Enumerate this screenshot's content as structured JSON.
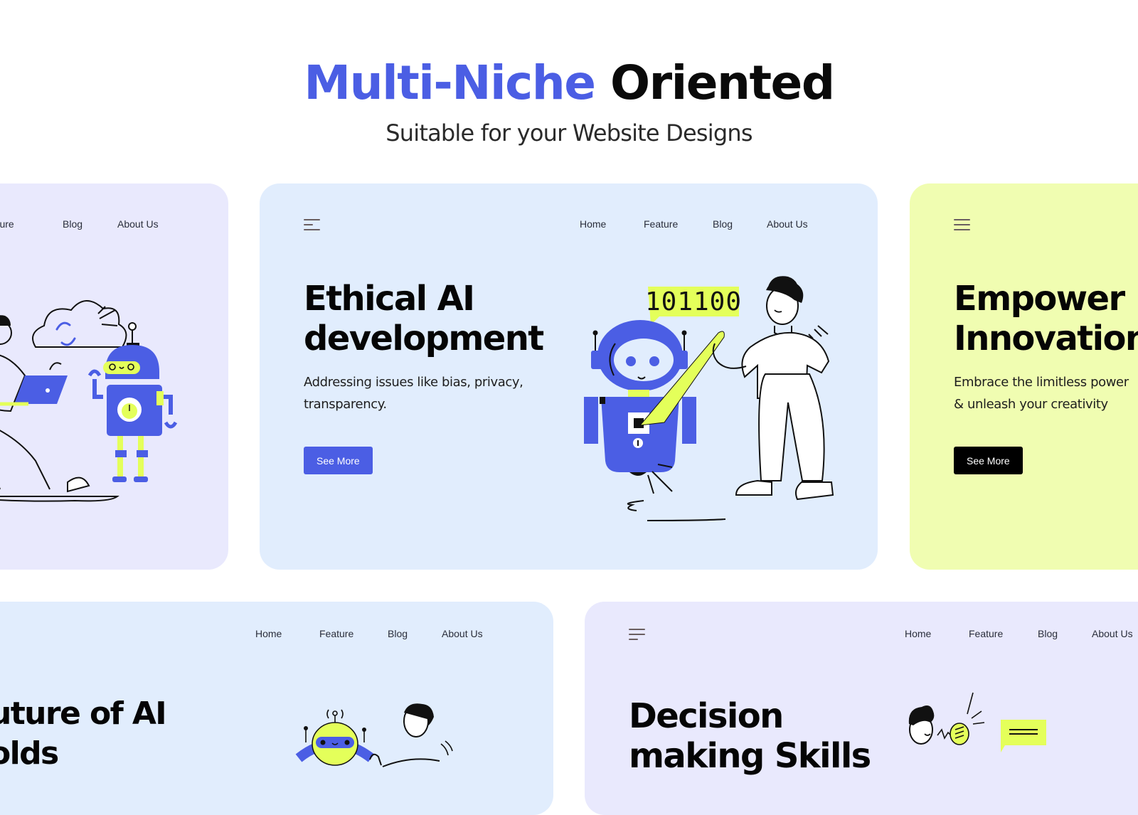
{
  "header": {
    "title_accent": "Multi-Niche",
    "title_rest": "Oriented",
    "subtitle": "Suitable for your Website Designs"
  },
  "colors": {
    "accent_blue": "#4b5ee4",
    "lime": "#e4ff5a",
    "card_lavender": "#e9e9fd",
    "card_blue": "#e1edfd",
    "card_lime": "#f0fdb1"
  },
  "nav_items": [
    "Home",
    "Feature",
    "Blog",
    "About Us"
  ],
  "cards": [
    {
      "nav_visible": [
        "eature",
        "Blog",
        "About Us"
      ],
      "illustration": "person-with-laptop-and-robot-with-cloud-sync"
    },
    {
      "headline_line1": "Ethical AI",
      "headline_line2": "development",
      "description_line1": "Addressing issues like bias, privacy,",
      "description_line2": "transparency.",
      "button_label": "See More",
      "speech_bubble_text": "101100",
      "illustration": "robot-and-person-high-five"
    },
    {
      "headline_line1": "Empower",
      "headline_line2": "Innovation",
      "description_line1": "Embrace the limitless power",
      "description_line2": "& unleash your creativity",
      "button_label": "See More"
    },
    {
      "headline_line1": "uture of AI",
      "headline_line2": "olds",
      "illustration": "robot-waving-and-person"
    },
    {
      "headline_line1": "Decision",
      "headline_line2": "making Skills",
      "illustration": "person-with-lightbulb-and-speech-bubble"
    }
  ]
}
